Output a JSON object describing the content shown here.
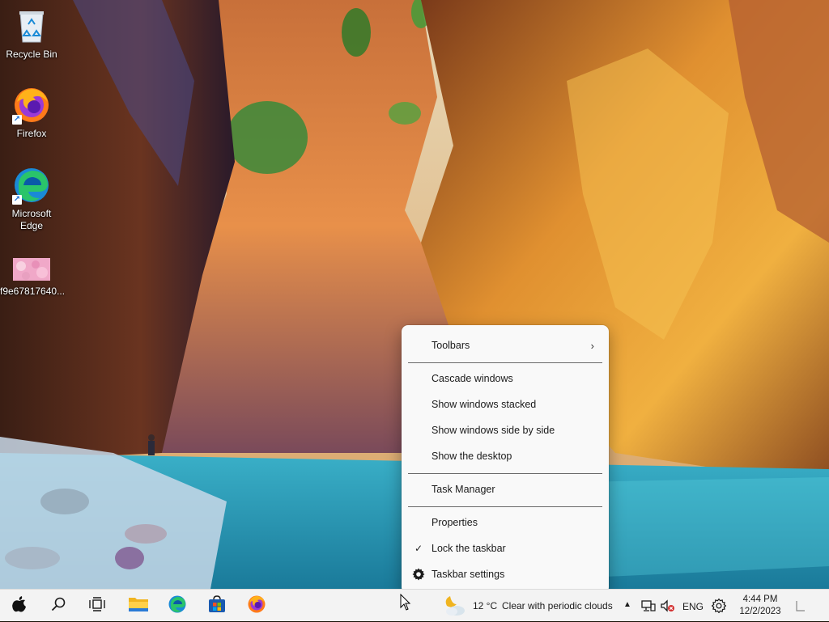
{
  "desktop": {
    "icons": [
      {
        "label": "Recycle Bin",
        "icon": "recycle-bin-icon"
      },
      {
        "label": "Firefox",
        "icon": "firefox-icon"
      },
      {
        "label": "Microsoft Edge",
        "icon": "edge-icon"
      },
      {
        "label": "f9e67817640...",
        "icon": "image-file-icon"
      }
    ]
  },
  "context_menu": {
    "items": [
      {
        "label": "Toolbars",
        "has_submenu": true,
        "chevron": "›"
      },
      {
        "label": "Cascade windows"
      },
      {
        "label": "Show windows stacked"
      },
      {
        "label": "Show windows side by side"
      },
      {
        "label": "Show the desktop"
      },
      {
        "label": "Task Manager"
      },
      {
        "label": "Properties"
      },
      {
        "label": "Lock the taskbar",
        "checked": true,
        "check": "✓"
      },
      {
        "label": "Taskbar settings",
        "icon": "gear-icon"
      }
    ]
  },
  "taskbar": {
    "pinned": [
      {
        "name": "start",
        "icon": "start-icon"
      },
      {
        "name": "search",
        "icon": "search-icon"
      },
      {
        "name": "task-view",
        "icon": "task-view-icon"
      },
      {
        "name": "file-explorer",
        "icon": "folder-icon"
      },
      {
        "name": "edge",
        "icon": "edge-icon"
      },
      {
        "name": "microsoft-store",
        "icon": "store-icon"
      },
      {
        "name": "firefox",
        "icon": "firefox-icon"
      }
    ],
    "weather": {
      "temp": "12 °C",
      "condition": "Clear with periodic clouds",
      "icon": "partly-cloudy-icon"
    },
    "tray": {
      "chevron": "▲",
      "language": "ENG",
      "network_icon": "network-icon",
      "volume_icon": "volume-muted-icon",
      "settings_icon": "gear-icon"
    },
    "clock": {
      "time": "4:44 PM",
      "date": "12/2/2023"
    }
  },
  "colors": {
    "menu_bg": "#f9f9f9",
    "taskbar_bg": "#f3f3f3",
    "accent": "#0067c0"
  }
}
